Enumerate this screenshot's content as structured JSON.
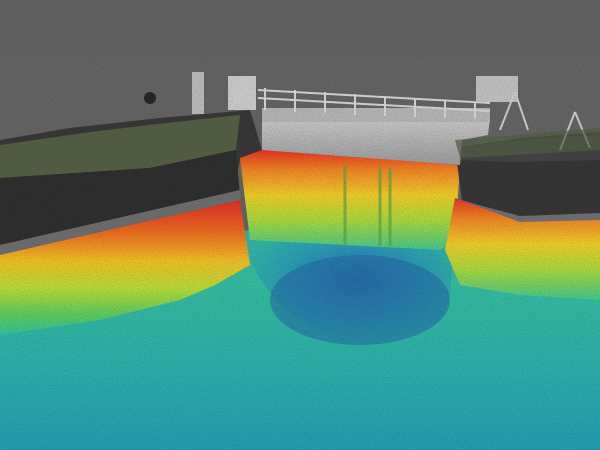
{
  "scene": {
    "subject": "lock-gate-point-cloud",
    "colors": {
      "background": "#5e5e5e",
      "deep": "#1f6fa8",
      "mid": "#20b3a6",
      "shallow": "#3ecf9a",
      "high": "#e23b1a",
      "stone": "#2e2e2e",
      "grass": "#4b5a3a",
      "gate": "#c9c9c9",
      "railing": "#d9d9d9"
    },
    "color_ramp": [
      "#e22a14",
      "#f26d14",
      "#f6c21c",
      "#c8df2a",
      "#64d14e",
      "#2cc39a",
      "#1d9fb8",
      "#1d6fae"
    ]
  }
}
